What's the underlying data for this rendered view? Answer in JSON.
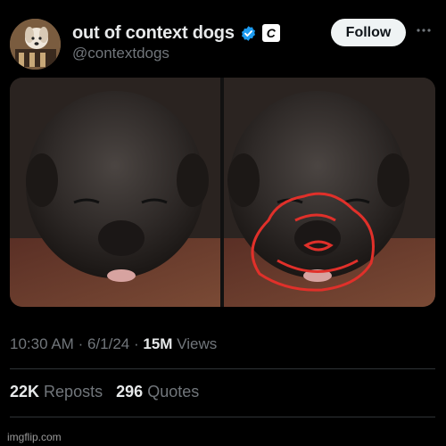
{
  "account": {
    "display_name": "out of context dogs",
    "handle": "@contextdogs",
    "verified_icon": "verified-badge-icon",
    "affiliate_badge_letter": "C",
    "avatar": "dog-avatar"
  },
  "header": {
    "follow_label": "Follow",
    "more_icon": "ellipsis-icon"
  },
  "post": {
    "time": "10:30 AM",
    "separator": "·",
    "date": "6/1/24",
    "views_count": "15M",
    "views_label": "Views",
    "reposts_count": "22K",
    "reposts_label": "Reposts",
    "quotes_count": "296",
    "quotes_label": "Quotes",
    "media_description_icon": "sleeping-puppy-photo"
  },
  "watermark": "imgflip.com",
  "colors": {
    "background": "#000000",
    "primary_text": "#e7e9ea",
    "secondary_text": "#71767b",
    "verified_blue": "#1d9bf0",
    "follow_bg": "#eff3f4",
    "annotation_red": "#e0302a"
  }
}
